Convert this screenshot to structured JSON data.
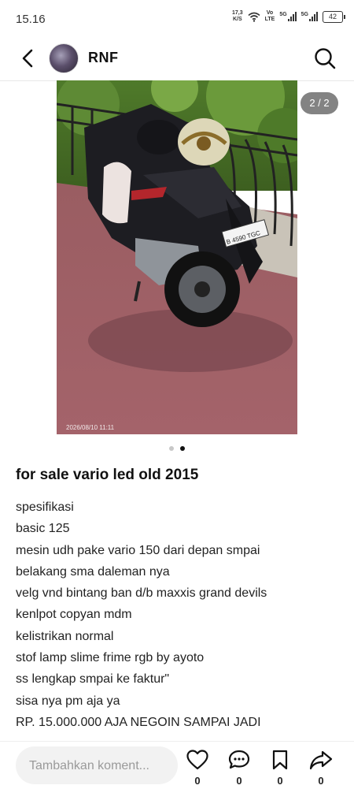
{
  "status_bar": {
    "time": "15.16",
    "net_speed": "17,3",
    "net_unit": "K/S",
    "volte_top": "Vo",
    "volte_bottom": "LTE",
    "sig1": "5G",
    "sig2": "5G",
    "battery": "42"
  },
  "header": {
    "username": "RNF",
    "back_icon": "back-arrow-icon",
    "search_icon": "search-icon"
  },
  "media": {
    "counter": "2 / 2",
    "photo_date": "2026/08/10 11:11",
    "plate": "B 4590 TGC",
    "plate_sub": "05 · 30",
    "dots_total": 2,
    "dots_active_index": 1
  },
  "post": {
    "title": "for sale vario led old 2015",
    "lines": [
      "spesifikasi",
      "basic 125",
      "mesin udh pake vario 150 dari depan smpai",
      "belakang sma daleman nya",
      "velg vnd bintang ban d/b maxxis grand devils",
      "kenlpot copyan mdm",
      "kelistrikan normal",
      "stof lamp slime frime rgb by ayoto",
      "ss lengkap smpai ke faktur\"",
      "sisa nya pm aja ya",
      "RP. 15.000.000 AJA NEGOIN SAMPAI JADI"
    ]
  },
  "bottom_bar": {
    "comment_placeholder": "Tambahkan koment...",
    "like_count": "0",
    "comment_count": "0",
    "save_count": "0",
    "share_count": "0"
  }
}
